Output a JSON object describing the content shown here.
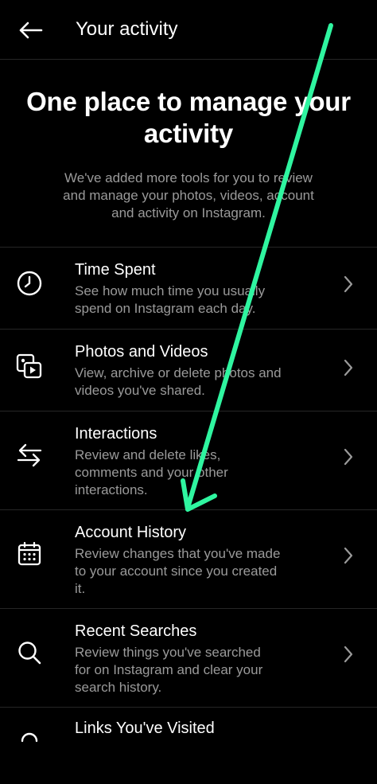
{
  "header": {
    "title": "Your activity",
    "back_icon": "back-arrow-icon"
  },
  "hero": {
    "title_line1": "One place to manage your",
    "title_line2": "activity",
    "desc_line1": "We've added more tools for you to review",
    "desc_line2": "and manage your photos, videos, account",
    "desc_line3": "and activity on Instagram."
  },
  "items": [
    {
      "icon": "clock-icon",
      "title": "Time Spent",
      "desc": [
        "See how much time you usually",
        "spend on Instagram each day."
      ]
    },
    {
      "icon": "photos-videos-icon",
      "title": "Photos and Videos",
      "desc": [
        "View, archive or delete photos and",
        "videos you've shared."
      ]
    },
    {
      "icon": "swap-arrows-icon",
      "title": "Interactions",
      "desc": [
        "Review and delete likes,",
        "comments and your other",
        "interactions."
      ]
    },
    {
      "icon": "calendar-icon",
      "title": "Account History",
      "desc": [
        "Review changes that you've made",
        "to your account since you created",
        "it."
      ]
    },
    {
      "icon": "search-icon",
      "title": "Recent Searches",
      "desc": [
        "Review things you've searched",
        "for on Instagram and clear your",
        "search history."
      ]
    },
    {
      "icon": "link-icon",
      "title": "Links You've Visited",
      "desc": []
    }
  ],
  "colors": {
    "background": "#000000",
    "text": "#ffffff",
    "secondary_text": "#9a9a9a",
    "divider": "#262626",
    "annotation_arrow": "#2ff5a0"
  }
}
